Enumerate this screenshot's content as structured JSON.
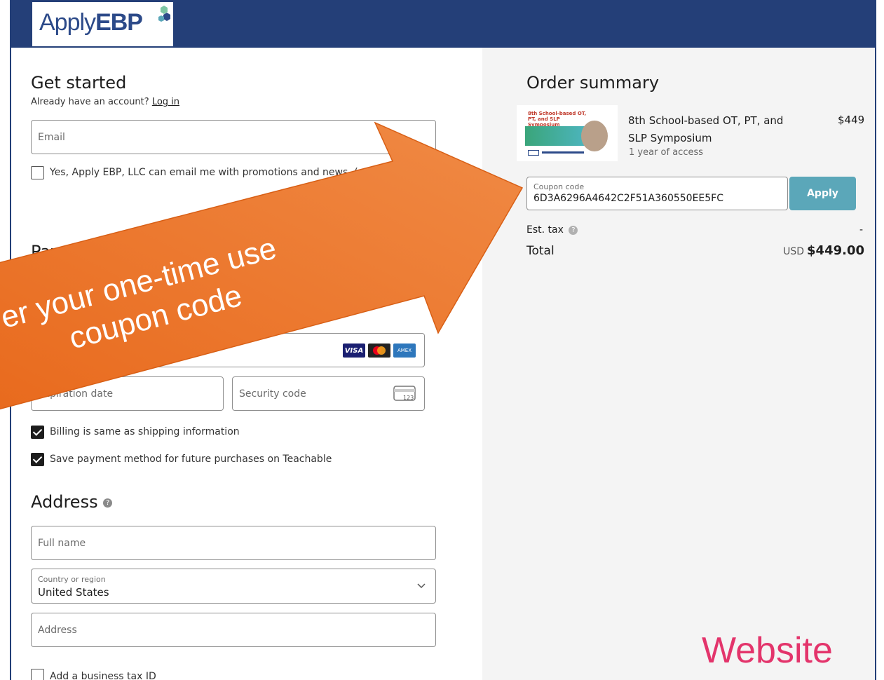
{
  "logo": {
    "text_light": "Apply",
    "text_bold": "EBP"
  },
  "get_started": {
    "title": "Get started",
    "have_account": "Already have an account?",
    "login_link": "Log in",
    "email_placeholder": "Email",
    "promo_checkbox_label": "Yes, Apply EBP, LLC can email me with promotions and news. (optional)",
    "promo_checked": false
  },
  "payment": {
    "title_partial": "Pay",
    "expiration_placeholder": "Expiration date",
    "security_placeholder": "Security code",
    "card_brands": [
      "VISA",
      "mastercard",
      "AMEX"
    ],
    "billing_same_label": "Billing is same as shipping information",
    "billing_same_checked": true,
    "save_method_label": "Save payment method for future purchases on Teachable",
    "save_method_checked": true
  },
  "address": {
    "title": "Address",
    "full_name_placeholder": "Full name",
    "country_label": "Country or region",
    "country_value": "United States",
    "address_placeholder": "Address",
    "business_tax_label": "Add a business tax ID",
    "business_tax_checked": false
  },
  "order_summary": {
    "title": "Order summary",
    "thumbnail_text": "8th School-based OT, PT, and SLP Symposium",
    "item_name": "8th School-based OT, PT, and SLP Symposium",
    "item_access": "1 year of access",
    "item_price": "$449",
    "coupon_label": "Coupon code",
    "coupon_value": "6D3A6296A4642C2F51A360550EE5FC",
    "apply_label": "Apply",
    "est_tax_label": "Est. tax",
    "est_tax_value": "-",
    "total_label": "Total",
    "total_currency": "USD",
    "total_value": "$449.00"
  },
  "callout": {
    "line1": "er your one-time use",
    "line2": "coupon code",
    "color": "#ef7a2a"
  },
  "watermark": "Website",
  "colors": {
    "header": "#243f78",
    "apply": "#5ba7b9",
    "watermark": "#e3346b"
  }
}
